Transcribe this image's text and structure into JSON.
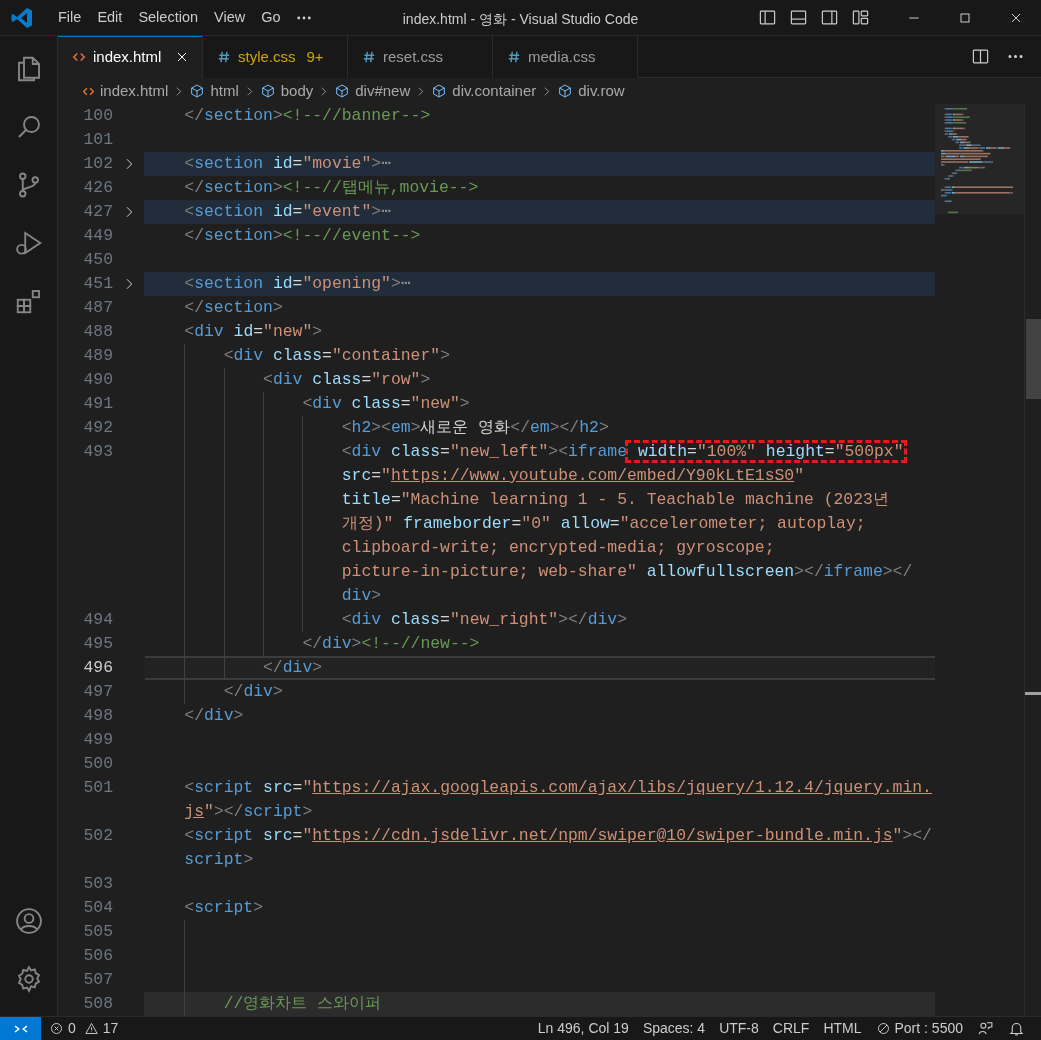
{
  "window": {
    "title": "index.html - 영화 - Visual Studio Code"
  },
  "menu": [
    "File",
    "Edit",
    "Selection",
    "View",
    "Go"
  ],
  "tabs": [
    {
      "label": "index.html",
      "kind": "html",
      "selected": true
    },
    {
      "label": "style.css",
      "kind": "css",
      "selected": false,
      "problems": "9+"
    },
    {
      "label": "reset.css",
      "kind": "css",
      "selected": false
    },
    {
      "label": "media.css",
      "kind": "css",
      "selected": false
    }
  ],
  "breadcrumb": [
    {
      "kind": "file",
      "label": "index.html"
    },
    {
      "kind": "element",
      "label": "html"
    },
    {
      "kind": "element",
      "label": "body"
    },
    {
      "kind": "element",
      "label": "div#new"
    },
    {
      "kind": "element",
      "label": "div.container"
    },
    {
      "kind": "element",
      "label": "div.row"
    }
  ],
  "code_lines": [
    {
      "number": "100",
      "folded": false,
      "current": false,
      "highlighted": false,
      "segments": [
        [
          {
            "kind": "punct",
            "text": "    </"
          },
          {
            "kind": "tag",
            "text": "section"
          },
          {
            "kind": "punct",
            "text": ">"
          },
          {
            "kind": "comment",
            "text": "<!--//banner-->"
          }
        ]
      ]
    },
    {
      "number": "101",
      "folded": false,
      "current": false,
      "highlighted": false
    },
    {
      "number": "102",
      "folded": true,
      "current": false,
      "highlighted": false,
      "segments": [
        [
          {
            "kind": "punct",
            "text": "    <"
          },
          {
            "kind": "tag",
            "text": "section"
          },
          {
            "kind": "attr",
            "text": " id"
          },
          {
            "kind": "text",
            "text": "="
          },
          {
            "kind": "string",
            "text": "\"movie\""
          },
          {
            "kind": "punct",
            "text": ">"
          },
          {
            "kind": "fold",
            "text": "⋯"
          }
        ]
      ]
    },
    {
      "number": "426",
      "folded": false,
      "current": false,
      "highlighted": false,
      "segments": [
        [
          {
            "kind": "punct",
            "text": "    </"
          },
          {
            "kind": "tag",
            "text": "section"
          },
          {
            "kind": "punct",
            "text": ">"
          },
          {
            "kind": "comment",
            "text": "<!--//탭메뉴,movie-->"
          }
        ]
      ]
    },
    {
      "number": "427",
      "folded": true,
      "current": false,
      "highlighted": false,
      "segments": [
        [
          {
            "kind": "punct",
            "text": "    <"
          },
          {
            "kind": "tag",
            "text": "section"
          },
          {
            "kind": "attr",
            "text": " id"
          },
          {
            "kind": "text",
            "text": "="
          },
          {
            "kind": "string",
            "text": "\"event\""
          },
          {
            "kind": "punct",
            "text": ">"
          },
          {
            "kind": "fold",
            "text": "⋯"
          }
        ]
      ]
    },
    {
      "number": "449",
      "folded": false,
      "current": false,
      "highlighted": false,
      "segments": [
        [
          {
            "kind": "punct",
            "text": "    </"
          },
          {
            "kind": "tag",
            "text": "section"
          },
          {
            "kind": "punct",
            "text": ">"
          },
          {
            "kind": "comment",
            "text": "<!--//event-->"
          }
        ]
      ]
    },
    {
      "number": "450",
      "folded": false,
      "current": false,
      "highlighted": false
    },
    {
      "number": "451",
      "folded": true,
      "current": false,
      "highlighted": false,
      "segments": [
        [
          {
            "kind": "punct",
            "text": "    <"
          },
          {
            "kind": "tag",
            "text": "section"
          },
          {
            "kind": "attr",
            "text": " id"
          },
          {
            "kind": "text",
            "text": "="
          },
          {
            "kind": "string",
            "text": "\"opening\""
          },
          {
            "kind": "punct",
            "text": ">"
          },
          {
            "kind": "fold",
            "text": "⋯"
          }
        ]
      ]
    },
    {
      "number": "487",
      "folded": false,
      "current": false,
      "highlighted": false,
      "segments": [
        [
          {
            "kind": "punct",
            "text": "    </"
          },
          {
            "kind": "tag",
            "text": "section"
          },
          {
            "kind": "punct",
            "text": ">"
          }
        ]
      ]
    },
    {
      "number": "488",
      "folded": false,
      "current": false,
      "highlighted": false,
      "segments": [
        [
          {
            "kind": "punct",
            "text": "    <"
          },
          {
            "kind": "tag",
            "text": "div"
          },
          {
            "kind": "attr",
            "text": " id"
          },
          {
            "kind": "text",
            "text": "="
          },
          {
            "kind": "string",
            "text": "\"new\""
          },
          {
            "kind": "punct",
            "text": ">"
          }
        ]
      ]
    },
    {
      "number": "489",
      "folded": false,
      "current": false,
      "highlighted": false,
      "segments": [
        [
          {
            "kind": "punct",
            "text": "        <"
          },
          {
            "kind": "tag",
            "text": "div"
          },
          {
            "kind": "attr",
            "text": " class"
          },
          {
            "kind": "text",
            "text": "="
          },
          {
            "kind": "string",
            "text": "\"container\""
          },
          {
            "kind": "punct",
            "text": ">"
          }
        ]
      ]
    },
    {
      "number": "490",
      "folded": false,
      "current": false,
      "highlighted": false,
      "segments": [
        [
          {
            "kind": "punct",
            "text": "            <"
          },
          {
            "kind": "tag",
            "text": "div"
          },
          {
            "kind": "attr",
            "text": " class"
          },
          {
            "kind": "text",
            "text": "="
          },
          {
            "kind": "string",
            "text": "\"row\""
          },
          {
            "kind": "punct",
            "text": ">"
          }
        ]
      ]
    },
    {
      "number": "491",
      "folded": false,
      "current": false,
      "highlighted": false,
      "segments": [
        [
          {
            "kind": "punct",
            "text": "                <"
          },
          {
            "kind": "tag",
            "text": "div"
          },
          {
            "kind": "attr",
            "text": " class"
          },
          {
            "kind": "text",
            "text": "="
          },
          {
            "kind": "string",
            "text": "\"new\""
          },
          {
            "kind": "punct",
            "text": ">"
          }
        ]
      ]
    },
    {
      "number": "492",
      "folded": false,
      "current": false,
      "highlighted": false,
      "segments": [
        [
          {
            "kind": "punct",
            "text": "                    <"
          },
          {
            "kind": "tag",
            "text": "h2"
          },
          {
            "kind": "punct",
            "text": "><"
          },
          {
            "kind": "tag",
            "text": "em"
          },
          {
            "kind": "punct",
            "text": ">"
          },
          {
            "kind": "text",
            "text": "새로운 영화"
          },
          {
            "kind": "punct",
            "text": "</"
          },
          {
            "kind": "tag",
            "text": "em"
          },
          {
            "kind": "punct",
            "text": "></"
          },
          {
            "kind": "tag",
            "text": "h2"
          },
          {
            "kind": "punct",
            "text": ">"
          }
        ]
      ]
    },
    {
      "number": "493",
      "folded": false,
      "current": false,
      "highlighted": false,
      "segments": [
        [
          {
            "kind": "punct",
            "text": "                    <"
          },
          {
            "kind": "tag",
            "text": "div"
          },
          {
            "kind": "attr",
            "text": " class"
          },
          {
            "kind": "text",
            "text": "="
          },
          {
            "kind": "string",
            "text": "\"new_left\""
          },
          {
            "kind": "punct",
            "text": ">"
          },
          {
            "kind": "punct",
            "text": "<"
          },
          {
            "kind": "tag",
            "text": "iframe"
          },
          {
            "kind": "boxed",
            "tokens": [
              {
                "kind": "attr",
                "text": " width"
              },
              {
                "kind": "text",
                "text": "="
              },
              {
                "kind": "string",
                "text": "\"100%\""
              },
              {
                "kind": "attr",
                "text": " height"
              },
              {
                "kind": "text",
                "text": "="
              },
              {
                "kind": "string",
                "text": "\"500px\""
              }
            ]
          }
        ],
        [
          {
            "kind": "attr",
            "text": "src"
          },
          {
            "kind": "text",
            "text": "="
          },
          {
            "kind": "string",
            "text": "\""
          },
          {
            "kind": "url",
            "text": "https://www.youtube.com/embed/Y90kLtE1sS0"
          },
          {
            "kind": "string",
            "text": "\""
          }
        ],
        [
          {
            "kind": "attr",
            "text": "title"
          },
          {
            "kind": "text",
            "text": "="
          },
          {
            "kind": "string",
            "text": "\"Machine learning 1 - 5. Teachable machine (2023년"
          }
        ],
        [
          {
            "kind": "string",
            "text": "개정)\""
          },
          {
            "kind": "attr",
            "text": " frameborder"
          },
          {
            "kind": "text",
            "text": "="
          },
          {
            "kind": "string",
            "text": "\"0\""
          },
          {
            "kind": "attr",
            "text": " allow"
          },
          {
            "kind": "text",
            "text": "="
          },
          {
            "kind": "string",
            "text": "\"accelerometer; autoplay;"
          }
        ],
        [
          {
            "kind": "string",
            "text": "clipboard-write; encrypted-media; gyroscope;"
          }
        ],
        [
          {
            "kind": "string",
            "text": "picture-in-picture; web-share\""
          },
          {
            "kind": "attr",
            "text": " allowfullscreen"
          },
          {
            "kind": "punct",
            "text": "></"
          },
          {
            "kind": "tag",
            "text": "iframe"
          },
          {
            "kind": "punct",
            "text": "></"
          }
        ],
        [
          {
            "kind": "tag",
            "text": "div"
          },
          {
            "kind": "punct",
            "text": ">"
          }
        ]
      ]
    },
    {
      "number": "494",
      "folded": false,
      "current": false,
      "highlighted": false,
      "segments": [
        [
          {
            "kind": "punct",
            "text": "                    <"
          },
          {
            "kind": "tag",
            "text": "div"
          },
          {
            "kind": "attr",
            "text": " class"
          },
          {
            "kind": "text",
            "text": "="
          },
          {
            "kind": "string",
            "text": "\"new_right\""
          },
          {
            "kind": "punct",
            "text": "></"
          },
          {
            "kind": "tag",
            "text": "div"
          },
          {
            "kind": "punct",
            "text": ">"
          }
        ]
      ]
    },
    {
      "number": "495",
      "folded": false,
      "current": false,
      "highlighted": false,
      "segments": [
        [
          {
            "kind": "punct",
            "text": "                </"
          },
          {
            "kind": "tag",
            "text": "div"
          },
          {
            "kind": "punct",
            "text": ">"
          },
          {
            "kind": "comment",
            "text": "<!--//new-->"
          }
        ]
      ]
    },
    {
      "number": "496",
      "folded": false,
      "current": true,
      "highlighted": false,
      "segments": [
        [
          {
            "kind": "punct",
            "text": "            </"
          },
          {
            "kind": "tag",
            "text": "div"
          },
          {
            "kind": "punct",
            "text": ">"
          }
        ]
      ]
    },
    {
      "number": "497",
      "folded": false,
      "current": false,
      "highlighted": false,
      "segments": [
        [
          {
            "kind": "punct",
            "text": "        </"
          },
          {
            "kind": "tag",
            "text": "div"
          },
          {
            "kind": "punct",
            "text": ">"
          }
        ]
      ]
    },
    {
      "number": "498",
      "folded": false,
      "current": false,
      "highlighted": false,
      "segments": [
        [
          {
            "kind": "punct",
            "text": "    </"
          },
          {
            "kind": "tag",
            "text": "div"
          },
          {
            "kind": "punct",
            "text": ">"
          }
        ]
      ]
    },
    {
      "number": "499",
      "folded": false,
      "current": false,
      "highlighted": false
    },
    {
      "number": "500",
      "folded": false,
      "current": false,
      "highlighted": false
    },
    {
      "number": "501",
      "folded": false,
      "current": false,
      "highlighted": false,
      "segments": [
        [
          {
            "kind": "punct",
            "text": "    <"
          },
          {
            "kind": "tag",
            "text": "script"
          },
          {
            "kind": "attr",
            "text": " src"
          },
          {
            "kind": "text",
            "text": "="
          },
          {
            "kind": "string",
            "text": "\""
          },
          {
            "kind": "url",
            "text": "https://ajax.googleapis.com/ajax/libs/jquery/1.12.4/jquery.min."
          }
        ],
        [
          {
            "kind": "url",
            "text": "js"
          },
          {
            "kind": "string",
            "text": "\""
          },
          {
            "kind": "punct",
            "text": "></"
          },
          {
            "kind": "tag",
            "text": "script"
          },
          {
            "kind": "punct",
            "text": ">"
          }
        ]
      ]
    },
    {
      "number": "502",
      "folded": false,
      "current": false,
      "highlighted": false,
      "segments": [
        [
          {
            "kind": "punct",
            "text": "    <"
          },
          {
            "kind": "tag",
            "text": "script"
          },
          {
            "kind": "attr",
            "text": " src"
          },
          {
            "kind": "text",
            "text": "="
          },
          {
            "kind": "string",
            "text": "\""
          },
          {
            "kind": "url",
            "text": "https://cdn.jsdelivr.net/npm/swiper@10/swiper-bundle.min.js"
          },
          {
            "kind": "string",
            "text": "\""
          },
          {
            "kind": "punct",
            "text": "></"
          }
        ],
        [
          {
            "kind": "tag",
            "text": "script"
          },
          {
            "kind": "punct",
            "text": ">"
          }
        ]
      ]
    },
    {
      "number": "503",
      "folded": false,
      "current": false,
      "highlighted": false
    },
    {
      "number": "504",
      "folded": false,
      "current": false,
      "highlighted": false,
      "segments": [
        [
          {
            "kind": "punct",
            "text": "    <"
          },
          {
            "kind": "tag",
            "text": "script"
          },
          {
            "kind": "punct",
            "text": ">"
          }
        ]
      ]
    },
    {
      "number": "505",
      "folded": false,
      "current": false,
      "highlighted": false
    },
    {
      "number": "506",
      "folded": false,
      "current": false,
      "highlighted": false
    },
    {
      "number": "507",
      "folded": false,
      "current": false,
      "highlighted": false
    },
    {
      "number": "508",
      "folded": false,
      "current": false,
      "highlighted": true,
      "segments": [
        [
          {
            "kind": "comment",
            "text": "        //영화차트 스와이퍼"
          }
        ]
      ]
    }
  ],
  "status_bar": {
    "left": [
      {
        "kind": "errors",
        "text": "0"
      },
      {
        "kind": "warnings",
        "text": "17"
      }
    ],
    "right": [
      {
        "kind": "text",
        "text": "Ln 496, Col 19"
      },
      {
        "kind": "text",
        "text": "Spaces: 4"
      },
      {
        "kind": "text",
        "text": "UTF-8"
      },
      {
        "kind": "text",
        "text": "CRLF"
      },
      {
        "kind": "text",
        "text": "HTML"
      },
      {
        "kind": "port",
        "text": "Port : 5500"
      }
    ]
  }
}
